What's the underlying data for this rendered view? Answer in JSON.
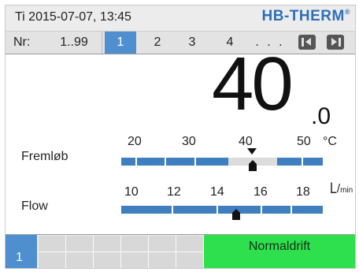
{
  "header": {
    "datetime": "Ti 2015-07-07, 13:45",
    "brand": "HB-THERM",
    "brand_mark": "®"
  },
  "nav": {
    "nr_label": "Nr:",
    "range": "1..99",
    "tabs": [
      "1",
      "2",
      "3",
      "4"
    ],
    "selected_tab": "1",
    "more": ". . .",
    "prev_icon": "skip-back-icon",
    "next_icon": "skip-forward-icon"
  },
  "main": {
    "value_int": "40",
    "value_dec": ".0"
  },
  "temperature": {
    "label": "Fremløb",
    "unit": "°C",
    "ticks": [
      "20",
      "30",
      "40",
      "50"
    ],
    "value": 40.0,
    "range": [
      15,
      53
    ]
  },
  "flow": {
    "label": "Flow",
    "unit_top": "L",
    "unit_bottom": "min",
    "ticks": [
      "10",
      "12",
      "14",
      "16",
      "18"
    ],
    "value": 14.9,
    "range": [
      10,
      19
    ]
  },
  "status": {
    "slot": "1",
    "mode": "Normaldrift"
  },
  "colors": {
    "accent_blue": "#4f8fd0",
    "bar_blue": "#3f7fbf",
    "ok_green": "#2ee04e",
    "brand_blue": "#2e6fb6"
  }
}
